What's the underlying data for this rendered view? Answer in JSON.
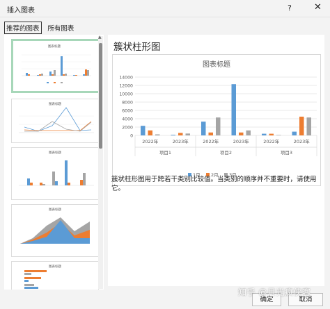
{
  "window": {
    "title": "插入图表",
    "help_glyph": "?",
    "close_glyph": "✕"
  },
  "tabs": [
    {
      "label": "推荐的图表",
      "active": true
    },
    {
      "label": "所有图表",
      "active": false
    }
  ],
  "thumbnails": [
    {
      "title": "图表标题",
      "type": "clustered-column",
      "selected": true
    },
    {
      "title": "图表标题",
      "type": "line",
      "selected": false
    },
    {
      "title": "图表标题",
      "type": "clustered-column",
      "selected": false
    },
    {
      "title": "图表标题",
      "type": "stacked-area",
      "selected": false
    },
    {
      "title": "图表标题",
      "type": "clustered-bar",
      "selected": false
    }
  ],
  "preview": {
    "chart_name": "簇状柱形图",
    "description": "簇状柱形图用于跨若干类别比较值。当类别的顺序并不重要时，请使用它。"
  },
  "chart_data": {
    "type": "bar",
    "title": "图表标题",
    "groups": [
      "项目1",
      "项目2",
      "项目3"
    ],
    "categories": [
      "2022年",
      "2023年",
      "2022年",
      "2023年",
      "2022年",
      "2023年"
    ],
    "series": [
      {
        "name": "1月",
        "color": "#5b9bd5",
        "values": [
          2300,
          150,
          3300,
          12300,
          400,
          900
        ]
      },
      {
        "name": "2月",
        "color": "#ed7d31",
        "values": [
          1200,
          600,
          700,
          700,
          400,
          4500
        ]
      },
      {
        "name": "3月",
        "color": "#a5a5a5",
        "values": [
          250,
          450,
          4300,
          1200,
          100,
          4300
        ]
      }
    ],
    "ylim": [
      0,
      14000
    ],
    "yticks": [
      "0",
      "2000",
      "4000",
      "6000",
      "8000",
      "10000",
      "12000",
      "14000"
    ],
    "grid": true,
    "legend_position": "bottom"
  },
  "buttons": {
    "ok": "确定",
    "cancel": "取消"
  },
  "watermark": "知乎 @月光疯侠客"
}
